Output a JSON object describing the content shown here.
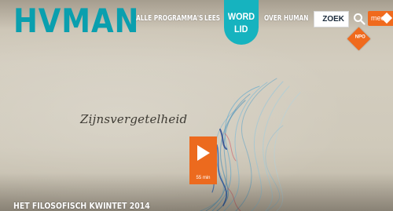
{
  "header": {
    "logo": "HVMAN",
    "nav": [
      {
        "label": "ALLE PROGRAMMA'S"
      },
      {
        "label": "LEES"
      },
      {
        "label": "OVER HUMAN"
      }
    ],
    "cta": {
      "line1": "WORD",
      "line2": "LID"
    },
    "search": {
      "placeholder": "ZOEK",
      "icon": "search-icon"
    },
    "meer": {
      "label": "meer",
      "icon": "diamond-icon"
    },
    "badge": {
      "label": "NPO"
    }
  },
  "hero": {
    "handwriting": "Zijnsvergetelheid",
    "play": {
      "duration": "55 min",
      "icon": "play-icon"
    },
    "caption": "HET FILOSOFISCH KWINTET 2014"
  },
  "colors": {
    "brand": "#0a9fae",
    "cta": "#16b3bf",
    "accent": "#ec6a1e"
  }
}
